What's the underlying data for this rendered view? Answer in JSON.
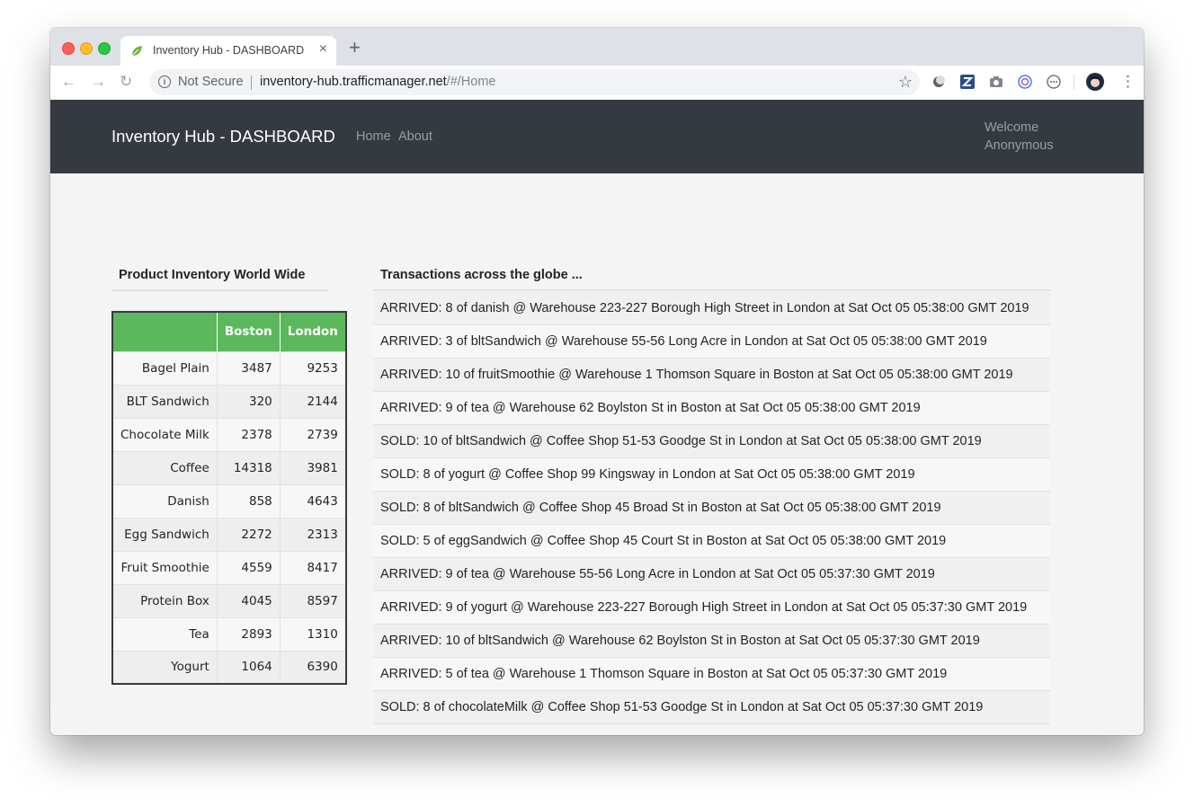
{
  "browser": {
    "tab_title": "Inventory Hub - DASHBOARD",
    "security_label": "Not Secure",
    "url_host": "inventory-hub.trafficmanager.net",
    "url_path": "/#/Home"
  },
  "navbar": {
    "brand": "Inventory Hub - DASHBOARD",
    "links": [
      "Home",
      "About"
    ],
    "welcome_line1": "Welcome",
    "welcome_line2": "Anonymous"
  },
  "inventory": {
    "heading": "Product Inventory World Wide",
    "columns": [
      "",
      "Boston",
      "London"
    ],
    "rows": [
      {
        "product": "Bagel Plain",
        "boston": "3487",
        "london": "9253"
      },
      {
        "product": "BLT Sandwich",
        "boston": "320",
        "london": "2144"
      },
      {
        "product": "Chocolate Milk",
        "boston": "2378",
        "london": "2739"
      },
      {
        "product": "Coffee",
        "boston": "14318",
        "london": "3981"
      },
      {
        "product": "Danish",
        "boston": "858",
        "london": "4643"
      },
      {
        "product": "Egg Sandwich",
        "boston": "2272",
        "london": "2313"
      },
      {
        "product": "Fruit Smoothie",
        "boston": "4559",
        "london": "8417"
      },
      {
        "product": "Protein Box",
        "boston": "4045",
        "london": "8597"
      },
      {
        "product": "Tea",
        "boston": "2893",
        "london": "1310"
      },
      {
        "product": "Yogurt",
        "boston": "1064",
        "london": "6390"
      }
    ],
    "header_color": "#5cb85c"
  },
  "transactions": {
    "heading": "Transactions across the globe ...",
    "items": [
      "ARRIVED: 8 of danish @ Warehouse 223-227 Borough High Street in London at Sat Oct 05 05:38:00 GMT 2019",
      "ARRIVED: 3 of bltSandwich @ Warehouse 55-56 Long Acre in London at Sat Oct 05 05:38:00 GMT 2019",
      "ARRIVED: 10 of fruitSmoothie @ Warehouse 1 Thomson Square in Boston at Sat Oct 05 05:38:00 GMT 2019",
      "ARRIVED: 9 of tea @ Warehouse 62 Boylston St in Boston at Sat Oct 05 05:38:00 GMT 2019",
      "SOLD: 10 of bltSandwich @ Coffee Shop 51-53 Goodge St in London at Sat Oct 05 05:38:00 GMT 2019",
      "SOLD: 8 of yogurt @ Coffee Shop 99 Kingsway in London at Sat Oct 05 05:38:00 GMT 2019",
      "SOLD: 8 of bltSandwich @ Coffee Shop 45 Broad St in Boston at Sat Oct 05 05:38:00 GMT 2019",
      "SOLD: 5 of eggSandwich @ Coffee Shop 45 Court St in Boston at Sat Oct 05 05:38:00 GMT 2019",
      "ARRIVED: 9 of tea @ Warehouse 55-56 Long Acre in London at Sat Oct 05 05:37:30 GMT 2019",
      "ARRIVED: 9 of yogurt @ Warehouse 223-227 Borough High Street in London at Sat Oct 05 05:37:30 GMT 2019",
      "ARRIVED: 10 of bltSandwich @ Warehouse 62 Boylston St in Boston at Sat Oct 05 05:37:30 GMT 2019",
      "ARRIVED: 5 of tea @ Warehouse 1 Thomson Square in Boston at Sat Oct 05 05:37:30 GMT 2019",
      "SOLD: 8 of chocolateMilk @ Coffee Shop 51-53 Goodge St in London at Sat Oct 05 05:37:30 GMT 2019"
    ]
  },
  "icons": {
    "favicon": "leaf-icon",
    "extensions": [
      "moon-icon",
      "z-extension-icon",
      "camera-icon",
      "circle-c-icon",
      "dots-circle-icon",
      "profile-avatar-icon",
      "kebab-menu-icon"
    ]
  }
}
